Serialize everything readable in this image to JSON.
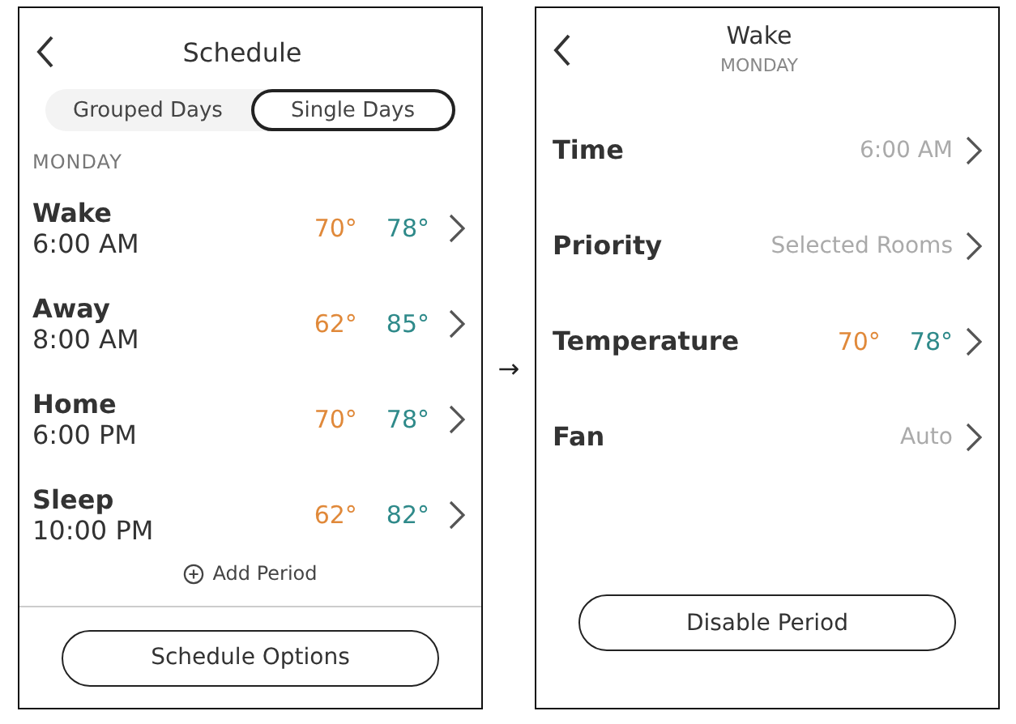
{
  "schedule_screen": {
    "title": "Schedule",
    "tabs": [
      {
        "label": "Grouped Days",
        "selected": false
      },
      {
        "label": "Single Days",
        "selected": true
      }
    ],
    "day": "MONDAY",
    "periods": [
      {
        "name": "Wake",
        "time": "6:00 AM",
        "heat": "70°",
        "cool": "78°"
      },
      {
        "name": "Away",
        "time": "8:00 AM",
        "heat": "62°",
        "cool": "85°"
      },
      {
        "name": "Home",
        "time": "6:00 PM",
        "heat": "70°",
        "cool": "78°"
      },
      {
        "name": "Sleep",
        "time": "10:00 PM",
        "heat": "62°",
        "cool": "82°"
      }
    ],
    "add_period": "Add Period",
    "button": "Schedule Options"
  },
  "connector": "→",
  "period_screen": {
    "title": "Wake",
    "subtitle": "MONDAY",
    "settings": [
      {
        "kind": "text",
        "label": "Time",
        "value": "6:00 AM"
      },
      {
        "kind": "text",
        "label": "Priority",
        "value": "Selected Rooms"
      },
      {
        "kind": "temps",
        "label": "Temperature",
        "heat": "70°",
        "cool": "78°"
      },
      {
        "kind": "text",
        "label": "Fan",
        "value": "Auto"
      }
    ],
    "button": "Disable Period"
  }
}
